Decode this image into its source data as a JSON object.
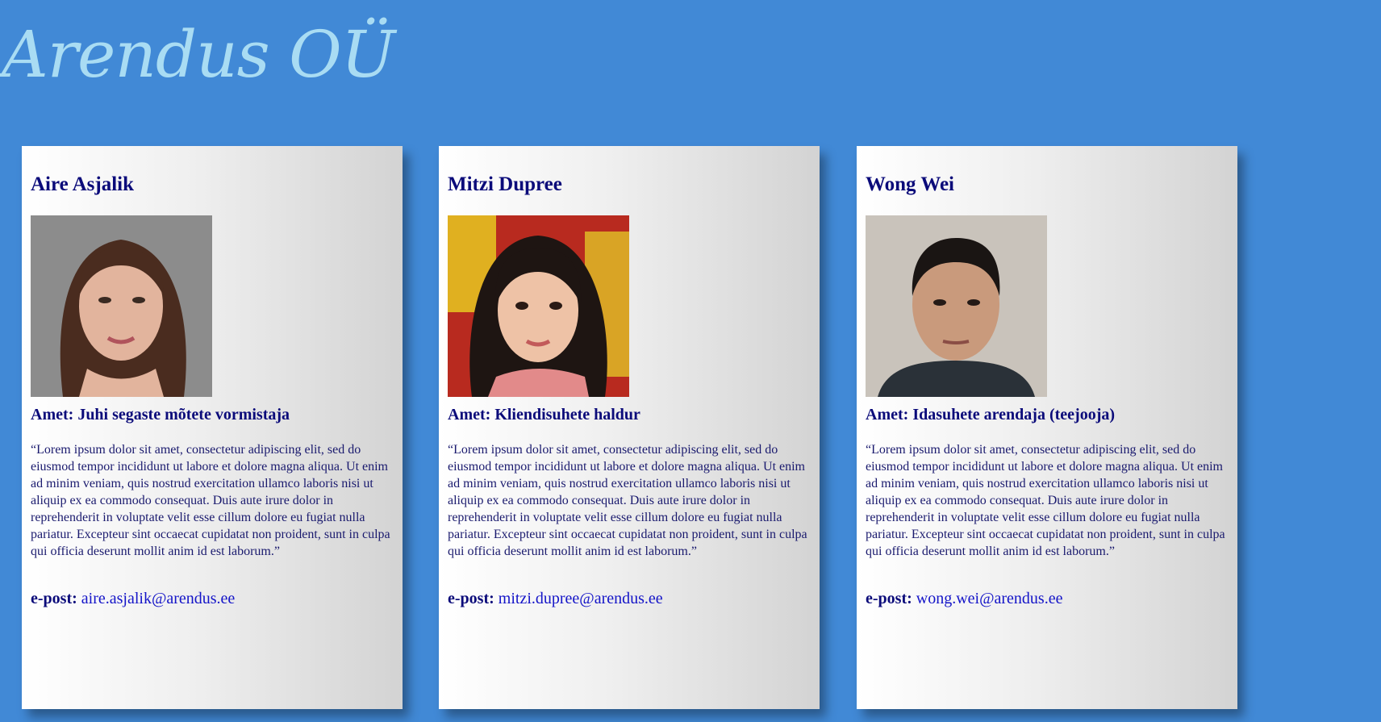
{
  "site": {
    "title": "Arendus OÜ"
  },
  "cards": [
    {
      "name": "Aire Asjalik",
      "role_label": "Amet:",
      "role": "Juhi segaste mõtete vormistaja",
      "quote": "“Lorem ipsum dolor sit amet, consectetur adipiscing elit, sed do eiusmod tempor incididunt ut labore et dolore magna aliqua. Ut enim ad minim veniam, quis nostrud exercitation ullamco laboris nisi ut aliquip ex ea commodo consequat. Duis aute irure dolor in reprehenderit in voluptate velit esse cillum dolore eu fugiat nulla pariatur. Excepteur sint occaecat cupidatat non proident, sunt in culpa qui officia deserunt mollit anim id est laborum.”",
      "email_label": "e-post:",
      "email": "aire.asjalik@arendus.ee"
    },
    {
      "name": "Mitzi Dupree",
      "role_label": "Amet:",
      "role": "Kliendisuhete haldur",
      "quote": "“Lorem ipsum dolor sit amet, consectetur adipiscing elit, sed do eiusmod tempor incididunt ut labore et dolore magna aliqua. Ut enim ad minim veniam, quis nostrud exercitation ullamco laboris nisi ut aliquip ex ea commodo consequat. Duis aute irure dolor in reprehenderit in voluptate velit esse cillum dolore eu fugiat nulla pariatur. Excepteur sint occaecat cupidatat non proident, sunt in culpa qui officia deserunt mollit anim id est laborum.”",
      "email_label": "e-post:",
      "email": "mitzi.dupree@arendus.ee"
    },
    {
      "name": "Wong Wei",
      "role_label": "Amet:",
      "role": "Idasuhete arendaja (teejooja)",
      "quote": "“Lorem ipsum dolor sit amet, consectetur adipiscing elit, sed do eiusmod tempor incididunt ut labore et dolore magna aliqua. Ut enim ad minim veniam, quis nostrud exercitation ullamco laboris nisi ut aliquip ex ea commodo consequat. Duis aute irure dolor in reprehenderit in voluptate velit esse cillum dolore eu fugiat nulla pariatur. Excepteur sint occaecat cupidatat non proident, sunt in culpa qui officia deserunt mollit anim id est laborum.”",
      "email_label": "e-post:",
      "email": "wong.wei@arendus.ee"
    }
  ],
  "colors": {
    "background": "#4189d6",
    "title": "#a9dcf3",
    "heading": "#0b0b7a",
    "link": "#1414c8"
  }
}
